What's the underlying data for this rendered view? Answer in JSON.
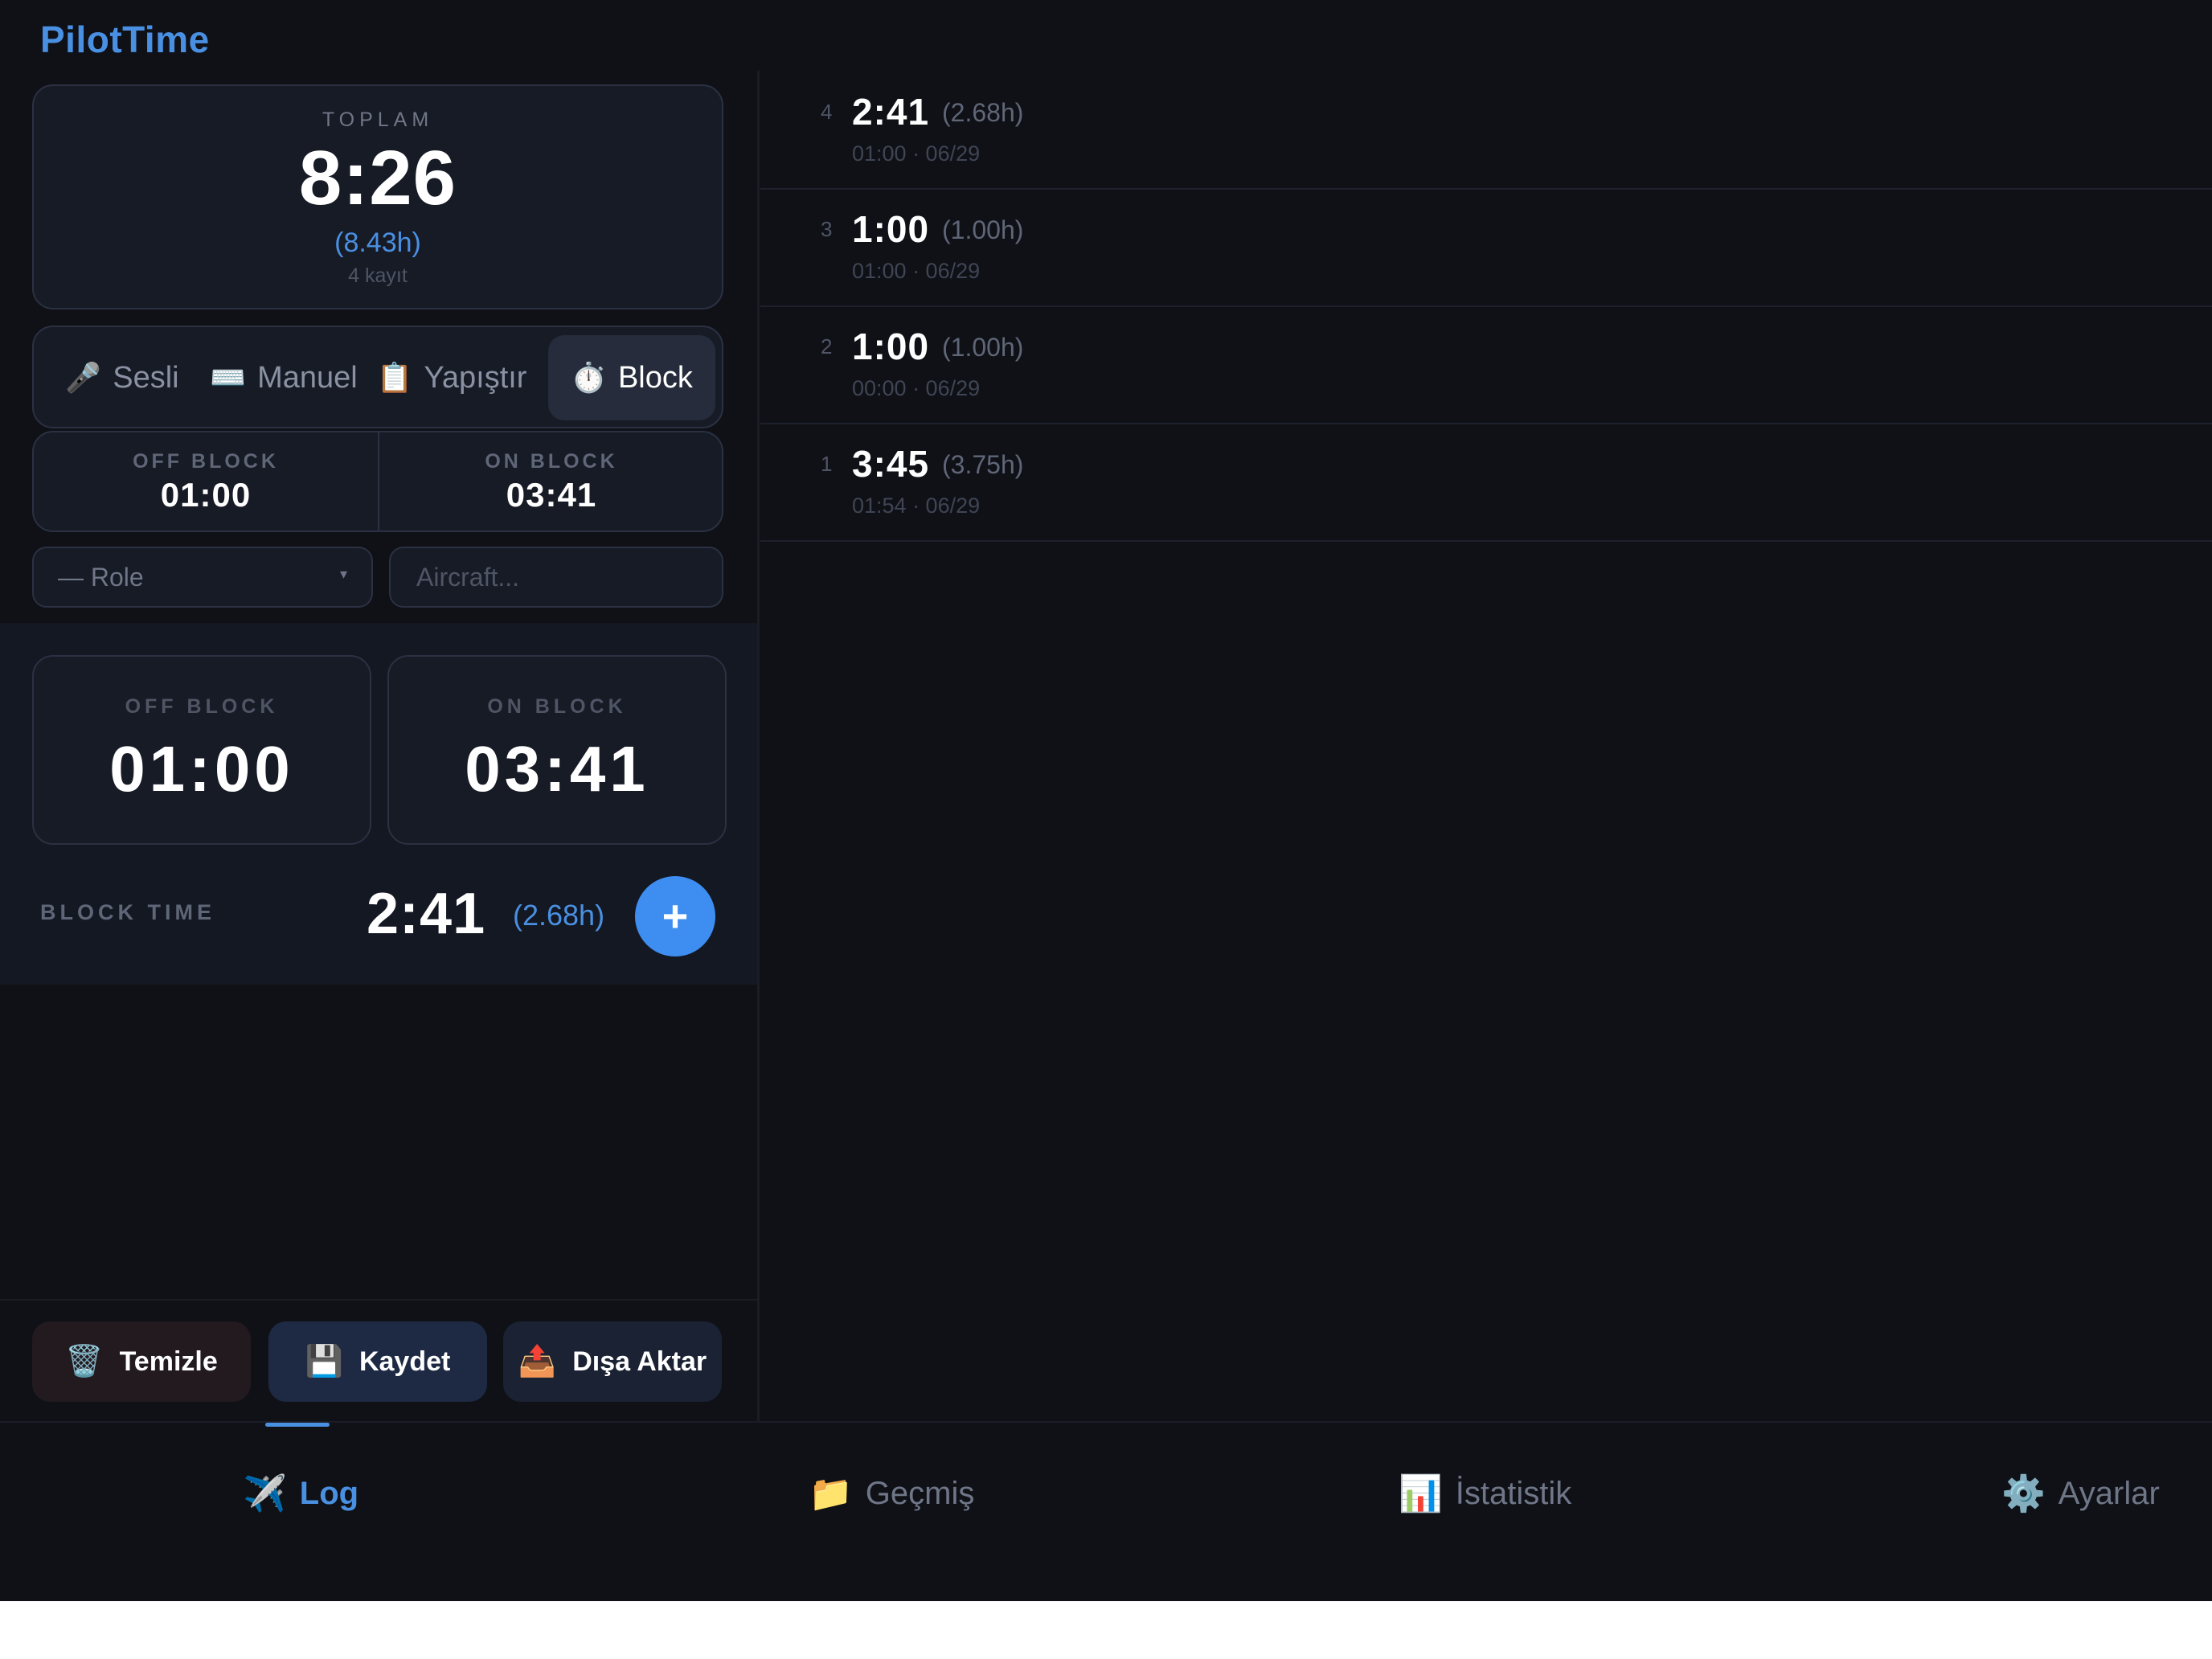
{
  "app": {
    "title": "PilotTime"
  },
  "summary": {
    "label": "TOPLAM",
    "total": "8:26",
    "hours": "(8.43h)",
    "count": "4 kayıt"
  },
  "modes": [
    {
      "icon": "🎤",
      "label": "Sesli",
      "active": false
    },
    {
      "icon": "⌨️",
      "label": "Manuel",
      "active": false
    },
    {
      "icon": "📋",
      "label": "Yapıştır",
      "active": false
    },
    {
      "icon": "⏱️",
      "label": "Block",
      "active": true
    }
  ],
  "times_small": {
    "off_label": "OFF BLOCK",
    "off_value": "01:00",
    "on_label": "ON BLOCK",
    "on_value": "03:41"
  },
  "form": {
    "role_value": "— Role",
    "aircraft_placeholder": "Aircraft..."
  },
  "block": {
    "off_label": "OFF BLOCK",
    "off_value": "01:00",
    "on_label": "ON BLOCK",
    "on_value": "03:41",
    "time_label": "BLOCK TIME",
    "time_value": "2:41",
    "time_hours": "(2.68h)",
    "add_label": "+"
  },
  "actions": {
    "clear_icon": "🗑️",
    "clear_label": "Temizle",
    "save_icon": "💾",
    "save_label": "Kaydet",
    "export_icon": "📤",
    "export_label": "Dışa Aktar"
  },
  "records": [
    {
      "index": "4",
      "time": "2:41",
      "hours": "(2.68h)",
      "meta": "01:00 · 06/29"
    },
    {
      "index": "3",
      "time": "1:00",
      "hours": "(1.00h)",
      "meta": "01:00 · 06/29"
    },
    {
      "index": "2",
      "time": "1:00",
      "hours": "(1.00h)",
      "meta": "00:00 · 06/29"
    },
    {
      "index": "1",
      "time": "3:45",
      "hours": "(3.75h)",
      "meta": "01:54 · 06/29"
    }
  ],
  "nav": [
    {
      "icon": "✈️",
      "label": "Log",
      "active": true
    },
    {
      "icon": "📁",
      "label": "Geçmiş",
      "active": false
    },
    {
      "icon": "📊",
      "label": "İstatistik",
      "active": false
    },
    {
      "icon": "⚙️",
      "label": "Ayarlar",
      "active": false
    }
  ],
  "colors": {
    "accent": "#4a90e2",
    "background": "#0f1117",
    "card": "#171b26",
    "add_button": "#3d8ef0"
  }
}
